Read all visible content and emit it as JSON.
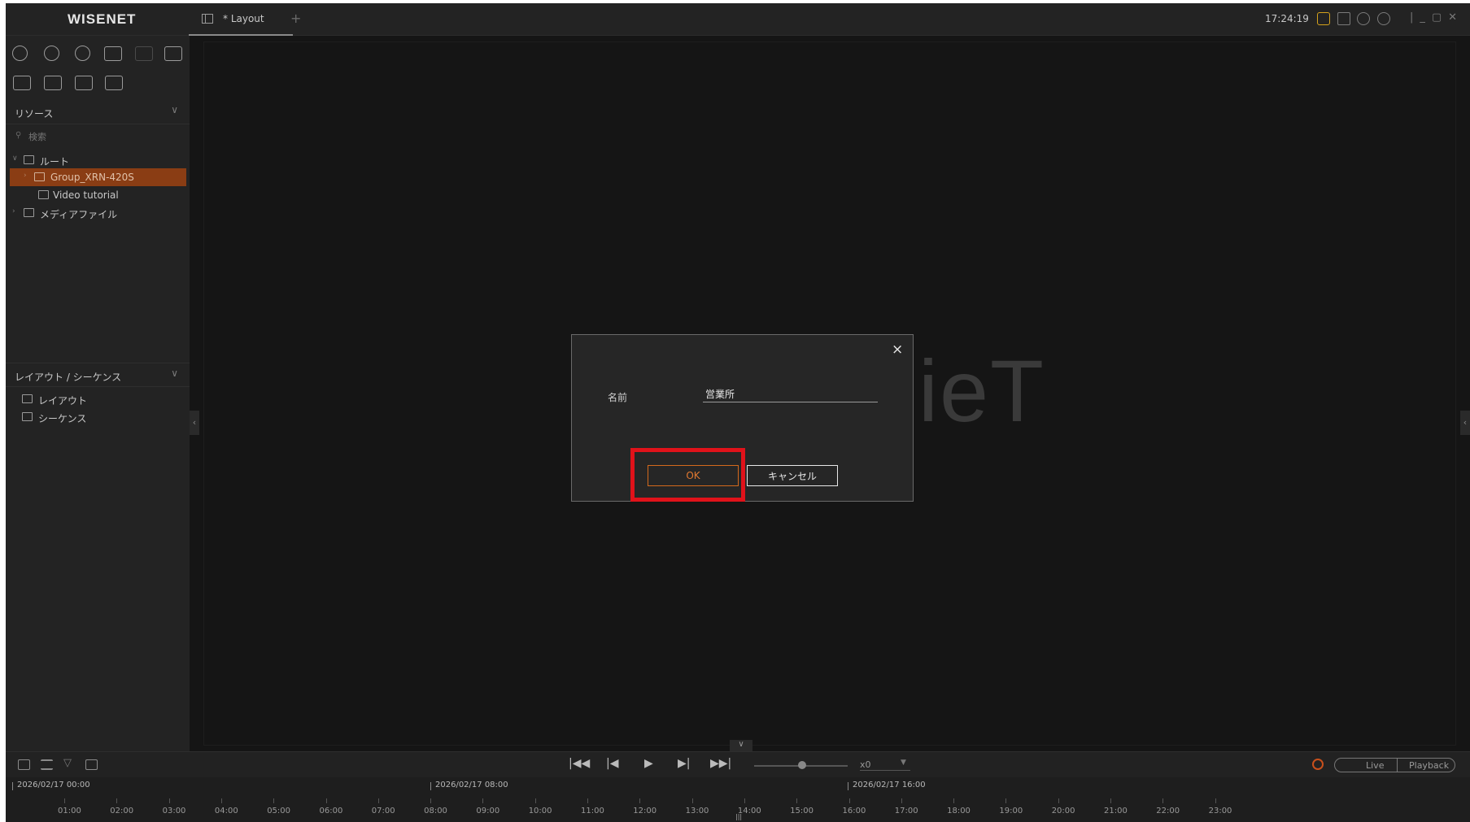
{
  "app": {
    "logo": "WISENET"
  },
  "tabs": [
    {
      "label": "* Layout"
    }
  ],
  "tab_add": "+",
  "clock": "17:24:19",
  "sidebar": {
    "resources_title": "リソース",
    "search_placeholder": "検索",
    "tree": [
      {
        "label": "ルート"
      },
      {
        "label": "Group_XRN-420S",
        "selected": true
      },
      {
        "label": "Video tutorial"
      },
      {
        "label": "メディアファイル"
      }
    ],
    "layouts_title": "レイアウト / シーケンス",
    "layouts": [
      {
        "label": "レイアウト"
      },
      {
        "label": "シーケンス"
      }
    ]
  },
  "main": {
    "watermark": "ieT"
  },
  "dialog": {
    "name_label": "名前",
    "name_value": "営業所",
    "ok_label": "OK",
    "cancel_label": "キャンセル",
    "close_glyph": "×"
  },
  "playback": {
    "speed": "x0",
    "live_label": "Live",
    "playback_label": "Playback"
  },
  "timeline": {
    "dates": [
      "2026/02/17 00:00",
      "2026/02/17 08:00",
      "2026/02/17 16:00"
    ],
    "hours": [
      "01:00",
      "02:00",
      "03:00",
      "04:00",
      "05:00",
      "06:00",
      "07:00",
      "08:00",
      "09:00",
      "10:00",
      "11:00",
      "12:00",
      "13:00",
      "14:00",
      "15:00",
      "16:00",
      "17:00",
      "18:00",
      "19:00",
      "20:00",
      "21:00",
      "22:00",
      "23:00"
    ]
  },
  "colors": {
    "accent": "#d4691c",
    "highlight": "#e0121a",
    "selection": "#8a3d14"
  }
}
